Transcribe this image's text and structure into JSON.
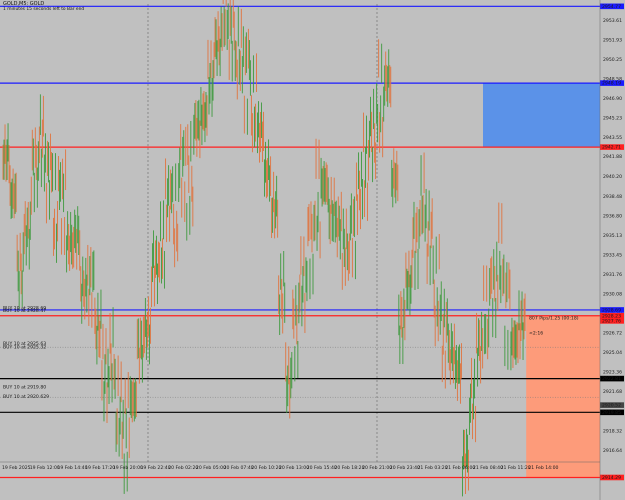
{
  "header": {
    "symbol": "GOLD,M5: GOLD",
    "subtitle": "1 minutes 15 seconds left to Bar end"
  },
  "chart_data": {
    "type": "candlestick",
    "y_range": [
      2915.63,
      2955.0
    ],
    "price_ticks": [
      "2953.61",
      "2951.93",
      "2950.25",
      "2948.58",
      "2946.90",
      "2945.23",
      "2943.55",
      "2941.88",
      "2940.20",
      "2938.48",
      "2936.80",
      "2935.13",
      "2933.45",
      "2931.76",
      "2930.08",
      "2928.40",
      "2926.72",
      "2925.04",
      "2923.36",
      "2921.68",
      "2920.00",
      "2918.32",
      "2916.64"
    ],
    "time_labels": [
      "19 Feb 2025",
      "19 Feb 12:00",
      "19 Feb 14:40",
      "19 Feb 17:20",
      "19 Feb 20:00",
      "19 Feb 22:40",
      "20 Feb 02:20",
      "20 Feb 05:00",
      "20 Feb 07:40",
      "20 Feb 10:20",
      "20 Feb 13:00",
      "20 Feb 15:40",
      "20 Feb 18:20",
      "20 Feb 21:00",
      "20 Feb 23:40",
      "21 Feb 03:20",
      "21 Feb 06:00",
      "21 Feb 08:40",
      "21 Feb 11:20",
      "21 Feb 14:00"
    ],
    "hlines": [
      {
        "price": 2954.8,
        "color": "#1a1aff",
        "tag": "2954.77"
      },
      {
        "price": 2948.2,
        "color": "#1a1aff",
        "tag": "2948.19"
      },
      {
        "price": 2942.7,
        "color": "#ff2020",
        "tag": "2942.71"
      },
      {
        "price": 2928.7,
        "color": "#1a1aff",
        "tag": "2928.69"
      },
      {
        "price": 2928.2,
        "color": "#ff2020",
        "tag": "2928.23"
      },
      {
        "price": 2922.8,
        "color": "#000000",
        "tag": "2922.81"
      },
      {
        "price": 2919.9,
        "color": "#000000",
        "tag": "2919.85"
      },
      {
        "price": 2914.3,
        "color": "#ff2020",
        "tag": "2914.29"
      }
    ],
    "order_labels": [
      {
        "text": "BUY 10 at 2928.69",
        "price": 2928.69
      },
      {
        "text": "BUY 10 at 2928.47",
        "price": 2928.47
      },
      {
        "text": "BUY 10 at 2925.63",
        "price": 2925.63
      },
      {
        "text": "BUY 10 at 2925.32",
        "price": 2925.32
      },
      {
        "text": "BUY 10 at 2919.80",
        "price": 2921.9
      },
      {
        "text": "BUY 10 at 2920.629",
        "price": 2921.1
      }
    ],
    "boxes": [
      {
        "name": "supply-zone",
        "color": "#5b92e8",
        "price_top": 2948.2,
        "price_bottom": 2942.7,
        "x_start_fraction": 0.805,
        "x_end_fraction": 1.0
      },
      {
        "name": "position-zone",
        "color": "#fd9b7a",
        "price_top": 2928.2,
        "price_bottom": 2914.3,
        "x_start_fraction": 0.877,
        "x_end_fraction": 1.0
      }
    ],
    "annotation": {
      "line1": "807 Pips/1.25 (00:18)",
      "line2": "<2:16"
    },
    "price_tags": [
      "2954.77",
      "2948.19",
      "2942.71",
      "2928.69",
      "2928.23",
      "2927.76",
      "2922.81",
      "2920.52",
      "2919.85",
      "2914.29"
    ],
    "candles": [
      2942.0,
      2938.5,
      2932.0,
      2935.5,
      2941.0,
      2943.2,
      2940.5,
      2937.0,
      2938.0,
      2934.5,
      2935.0,
      2930.5,
      2931.0,
      2927.0,
      2923.2,
      2924.5,
      2920.0,
      2918.2,
      2921.0,
      2925.5,
      2927.0,
      2932.5,
      2934.0,
      2938.0,
      2936.5,
      2941.0,
      2940.0,
      2944.5,
      2945.5,
      2948.5,
      2951.5,
      2954.2,
      2952.5,
      2950.5,
      2949.0,
      2946.0,
      2944.0,
      2940.5,
      2937.5,
      2930.0,
      2922.5,
      2927.0,
      2931.0,
      2934.5,
      2938.0,
      2939.5,
      2937.0,
      2936.0,
      2934.0,
      2935.5,
      2939.0,
      2941.0,
      2943.5,
      2946.5,
      2948.5,
      2940.0,
      2927.5,
      2931.0,
      2934.5,
      2938.0,
      2935.0,
      2930.0,
      2926.5,
      2925.0,
      2923.5,
      2916.0,
      2921.0,
      2925.5,
      2928.0,
      2930.5,
      2933.0,
      2929.0,
      2926.0,
      2927.5
    ]
  }
}
